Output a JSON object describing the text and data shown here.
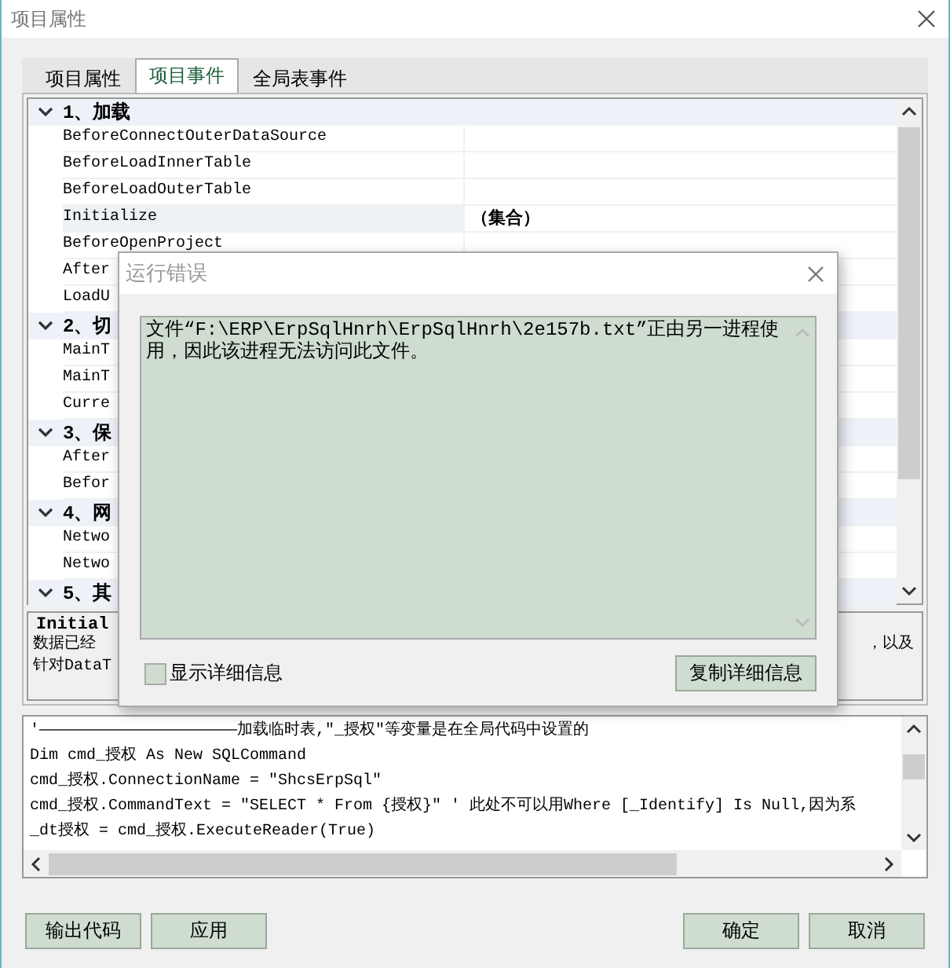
{
  "window": {
    "title": "项目属性"
  },
  "tabs": [
    {
      "label": "项目属性",
      "selected": false
    },
    {
      "label": "项目事件",
      "selected": true
    },
    {
      "label": "全局表事件",
      "selected": false
    }
  ],
  "property_grid": {
    "groups": [
      {
        "title": "1、加载",
        "expanded": true,
        "rows": [
          {
            "name": "BeforeConnectOuterDataSource",
            "selected": false
          },
          {
            "name": "BeforeLoadInnerTable",
            "selected": false
          },
          {
            "name": "BeforeLoadOuterTable",
            "selected": false
          },
          {
            "name": "Initialize",
            "value": "（集合）",
            "selected": true
          },
          {
            "name": "BeforeOpenProject",
            "selected": false
          },
          {
            "name": "After",
            "selected": false
          },
          {
            "name": "LoadU",
            "selected": false
          }
        ]
      },
      {
        "title": "2、切",
        "expanded": true,
        "rows": [
          {
            "name": "MainT",
            "selected": false
          },
          {
            "name": "MainT",
            "selected": false
          },
          {
            "name": "Curre",
            "selected": false
          }
        ]
      },
      {
        "title": "3、保",
        "expanded": true,
        "rows": [
          {
            "name": "After",
            "selected": false
          },
          {
            "name": "Befor",
            "selected": false
          }
        ]
      },
      {
        "title": "4、网",
        "expanded": true,
        "rows": [
          {
            "name": "Netwo",
            "selected": false
          },
          {
            "name": "Netwo",
            "selected": false
          }
        ]
      },
      {
        "title": "5、其",
        "expanded": true
      }
    ]
  },
  "description": {
    "title": "Initial",
    "lines": [
      {
        "left": "数据已经",
        "right": "，以及"
      },
      {
        "left": "针对DataT"
      }
    ]
  },
  "code_lines": [
    "'—————————————————————加载临时表,\"_授权\"等变量是在全局代码中设置的",
    "Dim cmd_授权 As New SQLCommand",
    "cmd_授权.ConnectionName = \"ShcsErpSql\"",
    "cmd_授权.CommandText = \"SELECT * From {授权}\" ' 此处不可以用Where [_Identify] Is Null,因为系",
    "_dt授权 = cmd_授权.ExecuteReader(True)"
  ],
  "buttons_left": [
    "输出代码",
    "应用"
  ],
  "buttons_right": [
    "确定",
    "取消"
  ],
  "error_dialog": {
    "title": "运行错误",
    "message": "文件“F:\\ERP\\ErpSqlHnrh\\ErpSqlHnrh\\2e157b.txt”正由另一进程使用，因此该进程无法访问此文件。",
    "checkbox": {
      "label": "显示详细信息",
      "checked": false
    },
    "copy_button": "复制详细信息"
  }
}
